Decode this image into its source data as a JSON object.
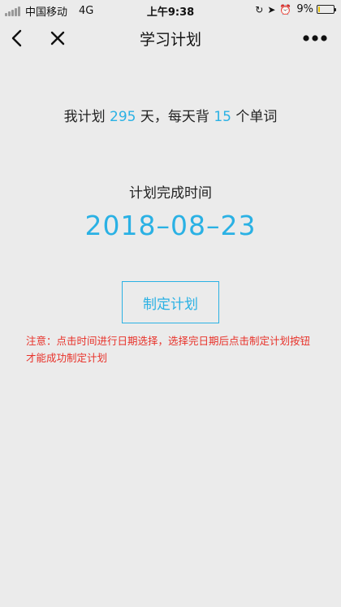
{
  "status_bar": {
    "carrier": "中国移动",
    "network": "4G",
    "time": "上午9:38",
    "battery": "9%",
    "battery_level": 0.09
  },
  "nav": {
    "title": "学习计划"
  },
  "plan": {
    "prefix": "我计划",
    "days": "295",
    "middle": "天，每天背",
    "words": "15",
    "suffix": "个单词"
  },
  "finish": {
    "label": "计划完成时间",
    "date": "2018–08–23"
  },
  "button": {
    "label": "制定计划"
  },
  "notice": {
    "text": "注意：点击时间进行日期选择，选择完日期后点击制定计划按钮才能成功制定计划"
  },
  "colors": {
    "accent": "#2ab1e4",
    "warning": "#e8322a",
    "background": "#ebebeb"
  }
}
